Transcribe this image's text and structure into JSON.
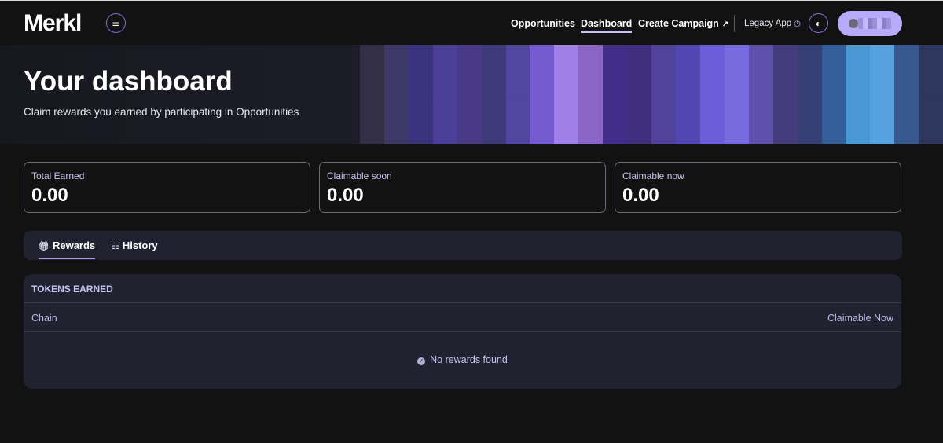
{
  "nav": {
    "logo": "Merkl",
    "menu_icon": "menu-icon",
    "links": {
      "opportunities": "Opportunities",
      "dashboard": "Dashboard",
      "create_campaign": "Create Campaign",
      "create_campaign_icon": "↗",
      "legacy_app": "Legacy App",
      "legacy_icon": "◷"
    },
    "theme_icon": "theme-toggle-icon"
  },
  "hero": {
    "title": "Your dashboard",
    "subtitle": "Claim rewards you earned by participating in Opportunities",
    "stripe_colors": [
      "#3a3550",
      "#3d3a6a",
      "#3b3580",
      "#5848b8",
      "#6a50d0",
      "#5f55c8",
      "#6a58d8",
      "#7e60e0",
      "#a080e8",
      "#a070e0",
      "#5a38c8",
      "#6040d0",
      "#7058e0",
      "#5a4ec8",
      "#6c5ed8",
      "#8070f0",
      "#7b68e8",
      "#6858c8",
      "#4a5ab0",
      "#3a70b8",
      "#4a9ad8",
      "#58a8e8",
      "#406ab0",
      "#3a4a88"
    ]
  },
  "stats": [
    {
      "label": "Total Earned",
      "value": "0.00"
    },
    {
      "label": "Claimable soon",
      "value": "0.00"
    },
    {
      "label": "Claimable now",
      "value": "0.00"
    }
  ],
  "tabs": [
    {
      "label": "Rewards",
      "icon": "gift-icon",
      "active": true
    },
    {
      "label": "History",
      "icon": "list-icon",
      "active": false
    }
  ],
  "table": {
    "title": "TOKENS EARNED",
    "columns": [
      "Chain",
      "Claimable Now"
    ],
    "empty_message": "No rewards found"
  },
  "colors": {
    "background": "#121212",
    "accent": "#b7aaf8",
    "panel": "#21222f",
    "label": "#c6c6f2"
  }
}
